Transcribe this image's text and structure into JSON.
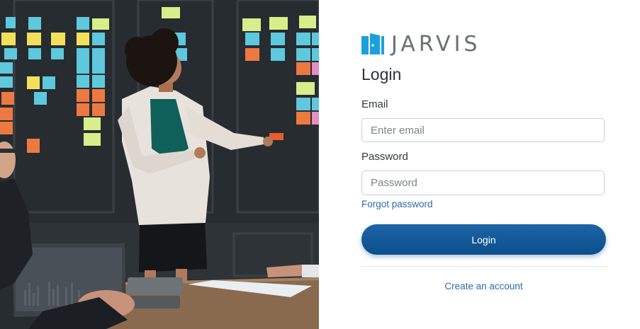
{
  "brand": {
    "name": "JARVIS",
    "accent": "#1aa1dc"
  },
  "login": {
    "title": "Login",
    "email_label": "Email",
    "email_placeholder": "Enter email",
    "password_label": "Password",
    "password_placeholder": "Password",
    "forgot_link": "Forgot password",
    "submit_label": "Login",
    "create_account_link": "Create an account"
  },
  "colors": {
    "button": "#0e5290",
    "link": "#2f6aa8"
  }
}
